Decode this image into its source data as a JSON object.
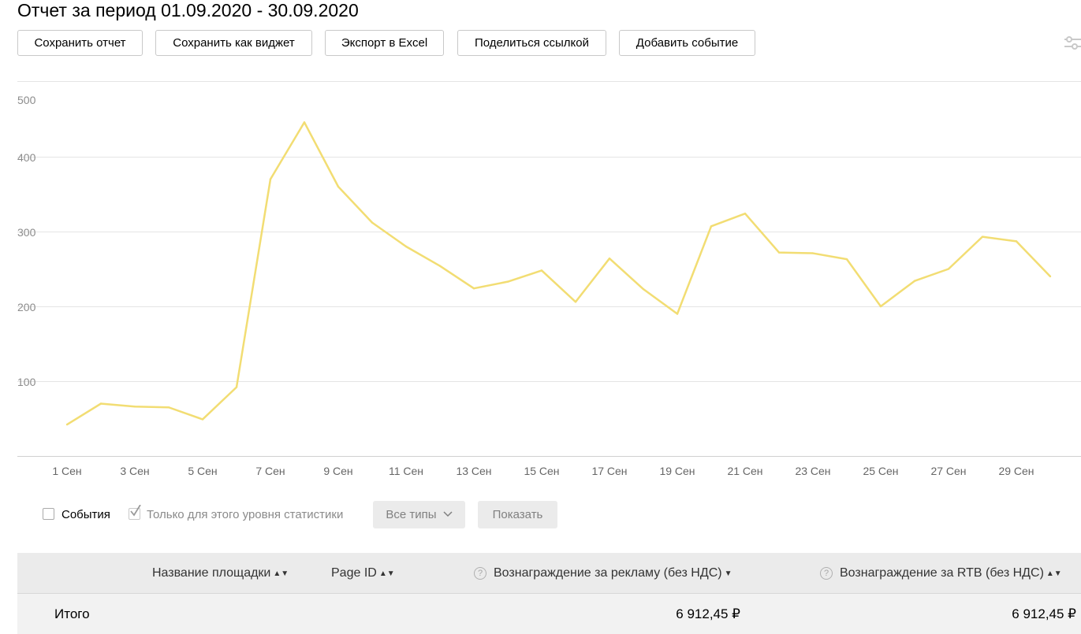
{
  "report": {
    "title": "Отчет за период 01.09.2020 - 30.09.2020"
  },
  "toolbar": {
    "save_report": "Сохранить отчет",
    "save_widget": "Сохранить как виджет",
    "export_excel": "Экспорт в Excel",
    "share_link": "Поделиться ссылкой",
    "add_event": "Добавить событие",
    "settings_icon": "sliders-icon"
  },
  "chart_data": {
    "type": "line",
    "title": "",
    "xlabel": "",
    "ylabel": "",
    "ylim": [
      0,
      500
    ],
    "y_ticks": [
      100,
      200,
      300,
      400,
      500
    ],
    "x_tick_labels": [
      "1 Сен",
      "3 Сен",
      "5 Сен",
      "7 Сен",
      "9 Сен",
      "11 Сен",
      "13 Сен",
      "15 Сен",
      "17 Сен",
      "19 Сен",
      "21 Сен",
      "23 Сен",
      "25 Сен",
      "27 Сен",
      "29 Сен"
    ],
    "x": [
      "1 Сен",
      "2 Сен",
      "3 Сен",
      "4 Сен",
      "5 Сен",
      "6 Сен",
      "7 Сен",
      "8 Сен",
      "9 Сен",
      "10 Сен",
      "11 Сен",
      "12 Сен",
      "13 Сен",
      "14 Сен",
      "15 Сен",
      "16 Сен",
      "17 Сен",
      "18 Сен",
      "19 Сен",
      "20 Сен",
      "21 Сен",
      "22 Сен",
      "23 Сен",
      "24 Сен",
      "25 Сен",
      "26 Сен",
      "27 Сен",
      "28 Сен",
      "29 Сен",
      "30 Сен"
    ],
    "series": [
      {
        "values": [
          42,
          70,
          66,
          65,
          49,
          92,
          370,
          446,
          360,
          312,
          280,
          254,
          224,
          233,
          248,
          206,
          264,
          223,
          190,
          307,
          324,
          272,
          271,
          263,
          200,
          234,
          250,
          293,
          287,
          240
        ],
        "color": "#f2dd73"
      }
    ],
    "grid": true,
    "legend": "none"
  },
  "events": {
    "events_label": "События",
    "only_level_label": "Только для этого уровня статистики",
    "types_label": "Все типы",
    "show_label": "Показать"
  },
  "table": {
    "columns": [
      "Название площадки",
      "Page ID",
      "Вознаграждение за рекламу (без НДС)",
      "Вознаграждение за RTB (без НДС)"
    ],
    "total_label": "Итого",
    "total_ad_reward": "6 912,45 ₽",
    "total_rtb_reward": "6 912,45 ₽"
  }
}
